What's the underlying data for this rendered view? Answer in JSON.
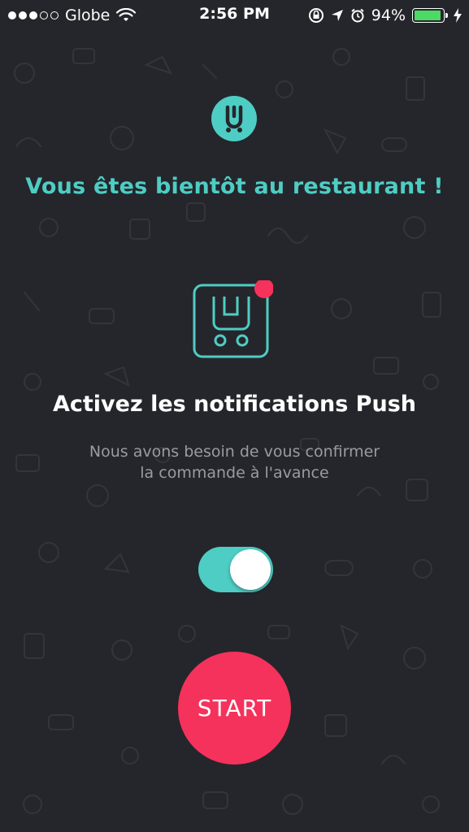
{
  "status_bar": {
    "carrier": "Globe",
    "time": "2:56 PM",
    "battery_percent": "94%",
    "battery_level": 0.94,
    "signal_bars_filled": 3,
    "signal_bars_total": 5
  },
  "main": {
    "headline": "Vous êtes bientôt au restaurant !",
    "title": "Activez les notifications Push",
    "subtitle_line1": "Nous avons besoin de vous confirmer",
    "subtitle_line2": "la commande à l'avance",
    "push_toggle_on": true,
    "start_label": "START"
  },
  "colors": {
    "background": "#25262b",
    "accent": "#4ecdc4",
    "start_button": "#f5325c",
    "notification_dot": "#f5325c"
  },
  "icons": {
    "logo": "u-cart-logo-icon",
    "push": "push-notification-icon"
  }
}
